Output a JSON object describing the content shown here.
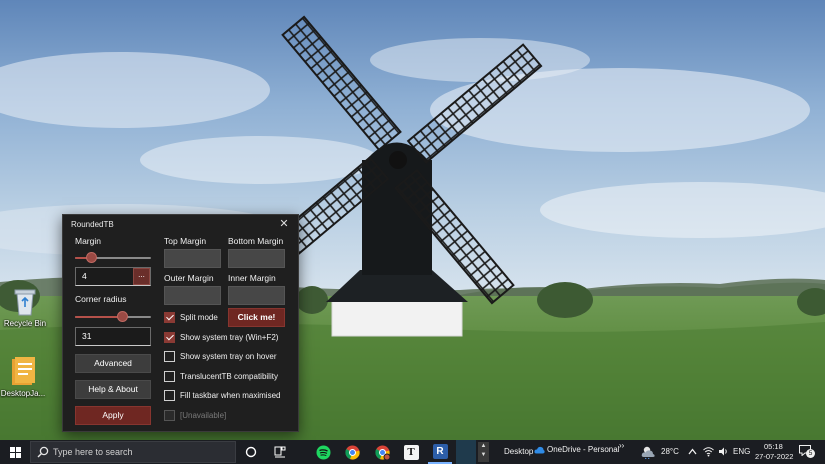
{
  "desktop": {
    "icons": [
      {
        "label": "Recycle Bin",
        "icon": "recycle-bin-icon"
      },
      {
        "label": "DesktopJa...",
        "icon": "document-stack-icon"
      }
    ]
  },
  "window": {
    "title": "RoundedTB",
    "close_glyph": "✕",
    "margin_label": "Margin",
    "margin_value": "4",
    "margin_slider_fraction": 0.22,
    "dots_label": "...",
    "corner_radius_label": "Corner radius",
    "corner_radius_value": "31",
    "corner_slider_fraction": 0.62,
    "top_margin_label": "Top Margin",
    "bottom_margin_label": "Bottom Margin",
    "outer_margin_label": "Outer Margin",
    "inner_margin_label": "Inner Margin",
    "click_me_label": "Click me!",
    "advanced_label": "Advanced",
    "help_about_label": "Help & About",
    "apply_label": "Apply",
    "options": [
      {
        "label": "Split mode",
        "checked": true
      },
      {
        "label": "Show system tray (Win+F2)",
        "checked": true
      },
      {
        "label": "Show system tray on hover",
        "checked": false
      },
      {
        "label": "TranslucentTB compatibility",
        "checked": false
      },
      {
        "label": "Fill taskbar when maximised",
        "checked": false
      },
      {
        "label": "[Unavailable]",
        "checked": false,
        "disabled": true
      }
    ],
    "accent_color": "#6f2722"
  },
  "taskbar": {
    "search_placeholder": "Type here to search",
    "pinned": [
      "task-view-icon",
      "widgets-icon",
      "spotify-icon",
      "chrome-icon",
      "chrome-profile-icon",
      "typora-icon",
      "roundedtb-icon"
    ],
    "roundedtb_letter": "R",
    "typora_letter": "T",
    "desktop_label": "Desktop",
    "onedrive_label": "OneDrive - Personal",
    "chevron_glyph": "››",
    "temperature": "28°C",
    "language": "ENG",
    "time": "05:18",
    "date": "27-07-2022",
    "notification_count": "5"
  }
}
